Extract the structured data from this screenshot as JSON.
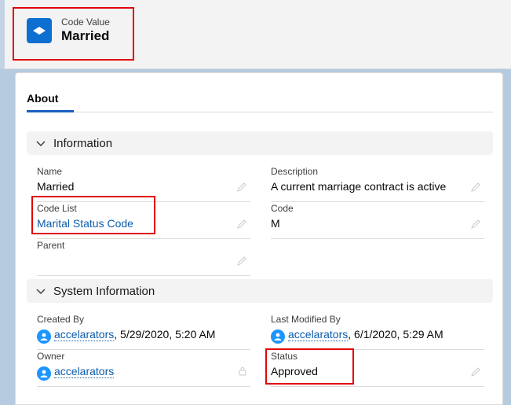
{
  "header": {
    "object_label": "Code Value",
    "record_name": "Married",
    "icon": "code-value-record-icon"
  },
  "tabs": [
    {
      "label": "About",
      "active": true
    }
  ],
  "sections": {
    "information": {
      "title": "Information",
      "fields": {
        "name": {
          "label": "Name",
          "value": "Married"
        },
        "description": {
          "label": "Description",
          "value": "A current marriage contract is active"
        },
        "code_list": {
          "label": "Code List",
          "value": "Marital Status Code"
        },
        "code": {
          "label": "Code",
          "value": "M"
        },
        "parent": {
          "label": "Parent",
          "value": ""
        }
      }
    },
    "system": {
      "title": "System Information",
      "fields": {
        "created_by": {
          "label": "Created By",
          "user": "accelarators",
          "date": ", 5/29/2020, 5:20 AM"
        },
        "last_modified_by": {
          "label": "Last Modified By",
          "user": "accelarators",
          "date": ", 6/1/2020, 5:29 AM"
        },
        "owner": {
          "label": "Owner",
          "user": "accelarators"
        },
        "status": {
          "label": "Status",
          "value": "Approved"
        }
      }
    }
  },
  "colors": {
    "brand": "#0d6fd0",
    "link": "#0b5cab",
    "highlight_box": "#e0060b",
    "tab_underline": "#1b5fc1"
  }
}
